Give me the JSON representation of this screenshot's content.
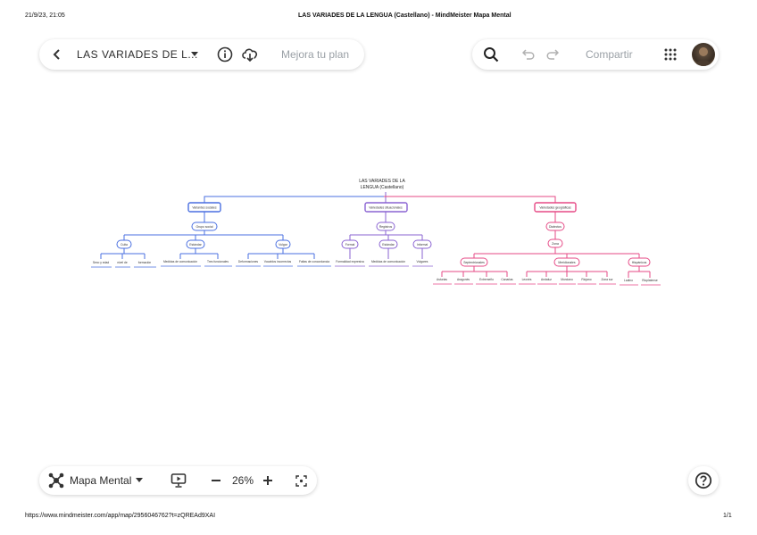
{
  "print": {
    "datetime": "21/9/23, 21:05",
    "doc_title": "LAS VARIADES DE LA LENGUA (Castellano) - MindMeister Mapa Mental",
    "url": "https://www.mindmeister.com/app/map/2956046762?t=zQREAd9XAI",
    "page": "1/1"
  },
  "toolbar_left": {
    "map_title": "LAS VARIADES DE L...",
    "upgrade_label": "Mejora tu plan"
  },
  "toolbar_right": {
    "share_label": "Compartir"
  },
  "bottom_bar": {
    "view_mode": "Mapa Mental",
    "zoom": "26%"
  },
  "colors": {
    "blue": "#4a6fe0",
    "purple": "#8a63d2",
    "pink": "#e64a86"
  },
  "mindmap": {
    "root": "LAS VARIADES DE LA",
    "root_line2": "LENGUA (Castellano)",
    "b1": {
      "label": "Variantes sociales",
      "child": "Grupo social",
      "subs": [
        "Culta",
        "Estándar",
        "Vulgar"
      ],
      "leaves": [
        "Sexo y edad",
        "nivel de",
        "formación",
        "Medidas de comunicación",
        "Tres funcionales",
        "Deformaciones",
        "Vocablos incorrectos",
        "Faltas de concordancia"
      ]
    },
    "b2": {
      "label": "Variedades situacionales",
      "child": "Registros",
      "subs": [
        "Formal",
        "Estándar",
        "Informal"
      ],
      "leaves": [
        "Formalidad expresiva",
        "Medidas de comunicación",
        "Vulgares"
      ]
    },
    "b3": {
      "label": "Variedades geográficas",
      "child": "Dialectos",
      "grand": "Zona",
      "subs": [
        "Septentrionales",
        "Meridionales",
        "Hispánicos"
      ],
      "leaves": [
        "Asturias",
        "Aragonés",
        "Extremeño",
        "Canarias",
        "Leonés",
        "Andaluz",
        "Murciano",
        "Riojano",
        "Zona sur",
        "Ladino",
        "Rioplatense"
      ]
    }
  }
}
